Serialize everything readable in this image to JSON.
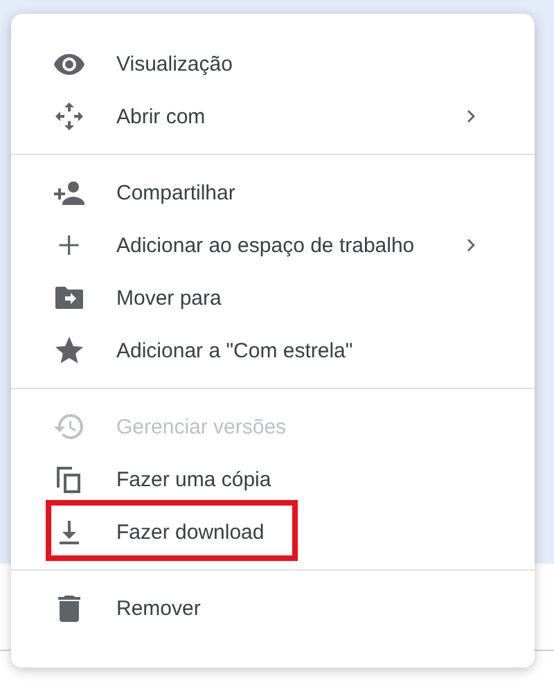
{
  "menu": {
    "groups": [
      {
        "items": [
          {
            "label": "Visualização",
            "disabled": false,
            "has_submenu": false,
            "highlighted": false
          },
          {
            "label": "Abrir com",
            "disabled": false,
            "has_submenu": true,
            "highlighted": false
          }
        ]
      },
      {
        "items": [
          {
            "label": "Compartilhar",
            "disabled": false,
            "has_submenu": false,
            "highlighted": false
          },
          {
            "label": "Adicionar ao espaço de trabalho",
            "disabled": false,
            "has_submenu": true,
            "highlighted": false
          },
          {
            "label": "Mover para",
            "disabled": false,
            "has_submenu": false,
            "highlighted": false
          },
          {
            "label": "Adicionar a \"Com estrela\"",
            "disabled": false,
            "has_submenu": false,
            "highlighted": false
          }
        ]
      },
      {
        "items": [
          {
            "label": "Gerenciar versões",
            "disabled": true,
            "has_submenu": false,
            "highlighted": false
          },
          {
            "label": "Fazer uma cópia",
            "disabled": false,
            "has_submenu": false,
            "highlighted": false
          },
          {
            "label": "Fazer download",
            "disabled": false,
            "has_submenu": false,
            "highlighted": true
          }
        ]
      },
      {
        "items": [
          {
            "label": "Remover",
            "disabled": false,
            "has_submenu": false,
            "highlighted": false
          }
        ]
      }
    ]
  }
}
